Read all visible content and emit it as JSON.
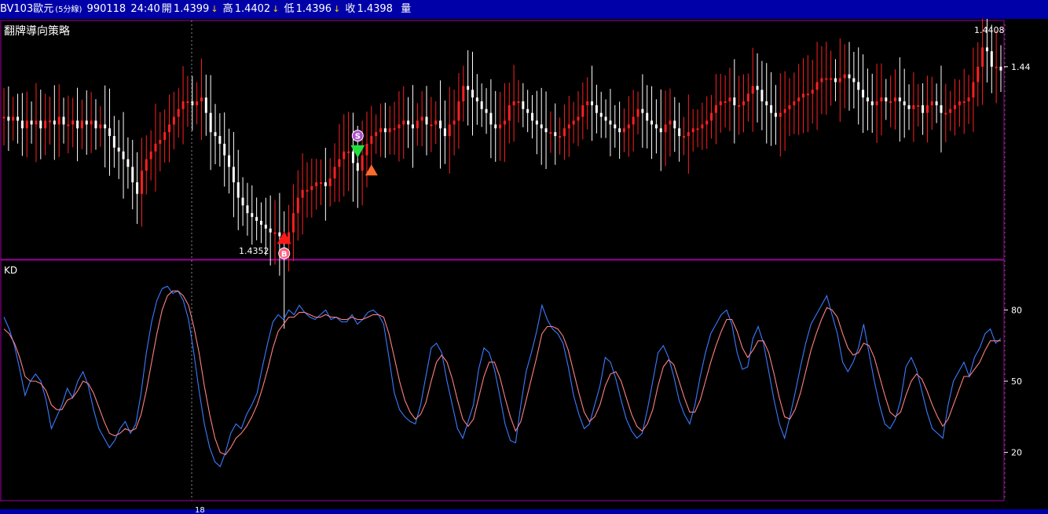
{
  "header": {
    "symbol": "BV103歐元",
    "interval": "(5分線)",
    "date": "990118",
    "time": "24:40",
    "open_label": "開",
    "open": "1.4399",
    "high_label": "高",
    "high": "1.4402",
    "low_label": "低",
    "low": "1.4396",
    "close_label": "收",
    "close": "1.4398",
    "volume_label": "量",
    "down_arrow": "↓"
  },
  "colors": {
    "background": "#000000",
    "titlebar": "#0000a8",
    "up_bar": "#ff2020",
    "down_bar": "#ffffff",
    "k_line": "#3a7bff",
    "d_line": "#ff8080",
    "frame": "#a000a0",
    "buy_marker": "#ff1a1a",
    "sell_marker": "#20e040",
    "alt_marker": "#ff6a2a"
  },
  "chart_data": [
    {
      "type": "bar",
      "title": "翻牌導向策略",
      "y_tick_labels": [
        "1.44"
      ],
      "high_label": "1.4408",
      "low_label": "1.4352",
      "ylim": [
        1.435,
        1.4412
      ],
      "session_divider_label": "18",
      "markers": [
        {
          "type": "buy",
          "label": "B",
          "price": 1.4354
        },
        {
          "type": "sell",
          "label": "S",
          "price": 1.4378
        },
        {
          "type": "up",
          "price": 1.4373
        }
      ],
      "series": [
        {
          "values": [
            1.4387,
            1.4386,
            1.4387,
            1.4386,
            1.4384,
            1.4386,
            1.4385,
            1.4386,
            1.4384,
            1.4386,
            1.4386,
            1.4385,
            1.4387,
            1.4385,
            1.4385,
            1.4386,
            1.4384,
            1.4386,
            1.4385,
            1.4386,
            1.4384,
            1.4385,
            1.4384,
            1.4382,
            1.4379,
            1.4378,
            1.4376,
            1.4374,
            1.437,
            1.4367,
            1.4373,
            1.4376,
            1.4378,
            1.438,
            1.4381,
            1.4383,
            1.4385,
            1.4387,
            1.4389,
            1.4391,
            1.4391,
            1.439,
            1.4391,
            1.4392,
            1.4388,
            1.4383,
            1.4382,
            1.438,
            1.4377,
            1.4374,
            1.437,
            1.4366,
            1.4364,
            1.4362,
            1.4361,
            1.436,
            1.4359,
            1.4358,
            1.4357,
            1.4357,
            1.4356,
            1.4354,
            1.4357,
            1.4362,
            1.4366,
            1.4368,
            1.4368,
            1.4369,
            1.437,
            1.437,
            1.4369,
            1.4371,
            1.4374,
            1.4376,
            1.4378,
            1.4378,
            1.4375,
            1.4373,
            1.4377,
            1.438,
            1.4382,
            1.4383,
            1.4384,
            1.4383,
            1.4384,
            1.4384,
            1.4385,
            1.4386,
            1.4385,
            1.4384,
            1.4386,
            1.4387,
            1.4385,
            1.4385,
            1.4386,
            1.4384,
            1.4382,
            1.4385,
            1.4386,
            1.4391,
            1.4395,
            1.4394,
            1.4392,
            1.4391,
            1.4389,
            1.4388,
            1.4385,
            1.4384,
            1.4385,
            1.4386,
            1.439,
            1.4391,
            1.4391,
            1.4389,
            1.4388,
            1.4386,
            1.4385,
            1.4384,
            1.4383,
            1.4383,
            1.4382,
            1.4382,
            1.4384,
            1.4385,
            1.4386,
            1.4387,
            1.439,
            1.4391,
            1.439,
            1.4388,
            1.4387,
            1.4386,
            1.4385,
            1.4384,
            1.4383,
            1.4384,
            1.4385,
            1.4387,
            1.4389,
            1.4388,
            1.4386,
            1.4385,
            1.4384,
            1.4383,
            1.4385,
            1.4386,
            1.4384,
            1.4382,
            1.4382,
            1.4383,
            1.4384,
            1.4384,
            1.4385,
            1.4386,
            1.4388,
            1.439,
            1.4391,
            1.4391,
            1.4392,
            1.439,
            1.439,
            1.4391,
            1.4393,
            1.4395,
            1.4394,
            1.4391,
            1.439,
            1.4388,
            1.4387,
            1.4388,
            1.4389,
            1.439,
            1.4391,
            1.4392,
            1.4393,
            1.4393,
            1.4394,
            1.4396,
            1.4397,
            1.4397,
            1.4397,
            1.4396,
            1.4397,
            1.4398,
            1.4397,
            1.4396,
            1.4394,
            1.4392,
            1.4391,
            1.439,
            1.4391,
            1.4392,
            1.4391,
            1.4391,
            1.4392,
            1.4391,
            1.439,
            1.4389,
            1.439,
            1.439,
            1.4388,
            1.439,
            1.4391,
            1.439,
            1.4388,
            1.4388,
            1.4389,
            1.439,
            1.4391,
            1.4391,
            1.4392,
            1.4396,
            1.44,
            1.4405,
            1.4404,
            1.44,
            1.44,
            1.4399
          ]
        }
      ]
    },
    {
      "type": "line",
      "title": "KD",
      "y_tick_labels": [
        "80",
        "50",
        "20"
      ],
      "ylim": [
        0,
        100
      ],
      "series": [
        {
          "name": "",
          "values": [
            77,
            72,
            65,
            55,
            44,
            50,
            53,
            50,
            42,
            30,
            35,
            40,
            47,
            43,
            50,
            54,
            48,
            38,
            30,
            26,
            22,
            25,
            30,
            33,
            28,
            32,
            45,
            62,
            75,
            84,
            89,
            90,
            87,
            88,
            84,
            76,
            62,
            46,
            32,
            22,
            16,
            14,
            20,
            28,
            32,
            30,
            36,
            40,
            45,
            56,
            66,
            75,
            78,
            76,
            80,
            78,
            82,
            79,
            77,
            76,
            78,
            80,
            76,
            77,
            75,
            75,
            78,
            74,
            76,
            79,
            80,
            78,
            74,
            60,
            45,
            38,
            35,
            33,
            32,
            40,
            52,
            64,
            66,
            62,
            50,
            40,
            30,
            26,
            33,
            40,
            55,
            64,
            62,
            55,
            44,
            32,
            25,
            24,
            40,
            54,
            62,
            71,
            82,
            76,
            72,
            70,
            66,
            56,
            44,
            36,
            30,
            32,
            40,
            48,
            60,
            58,
            51,
            42,
            34,
            29,
            26,
            28,
            38,
            50,
            62,
            65,
            60,
            52,
            42,
            36,
            32,
            40,
            52,
            62,
            70,
            74,
            78,
            80,
            74,
            62,
            55,
            56,
            68,
            73,
            66,
            54,
            42,
            32,
            26,
            35,
            45,
            56,
            66,
            74,
            78,
            82,
            86,
            78,
            70,
            58,
            54,
            58,
            64,
            74,
            62,
            50,
            40,
            32,
            30,
            34,
            42,
            56,
            60,
            55,
            46,
            37,
            30,
            28,
            26,
            40,
            50,
            54,
            58,
            52,
            60,
            64,
            70,
            72,
            66,
            68
          ]
        },
        {
          "name": "",
          "values": [
            72,
            70,
            66,
            60,
            52,
            50,
            50,
            49,
            46,
            40,
            38,
            38,
            42,
            43,
            46,
            50,
            49,
            45,
            39,
            33,
            28,
            27,
            28,
            30,
            29,
            30,
            36,
            46,
            58,
            70,
            80,
            86,
            88,
            88,
            86,
            82,
            73,
            62,
            48,
            36,
            26,
            20,
            19,
            22,
            26,
            28,
            31,
            35,
            40,
            47,
            55,
            64,
            71,
            74,
            77,
            77,
            79,
            79,
            78,
            77,
            77,
            78,
            77,
            77,
            76,
            76,
            77,
            76,
            76,
            77,
            78,
            78,
            77,
            70,
            60,
            50,
            42,
            37,
            34,
            36,
            41,
            50,
            58,
            61,
            58,
            51,
            42,
            34,
            31,
            34,
            43,
            52,
            58,
            58,
            52,
            43,
            35,
            29,
            33,
            42,
            51,
            60,
            70,
            73,
            73,
            72,
            69,
            63,
            54,
            45,
            37,
            33,
            35,
            40,
            48,
            53,
            54,
            50,
            43,
            36,
            31,
            29,
            32,
            38,
            48,
            56,
            59,
            57,
            50,
            43,
            37,
            37,
            42,
            50,
            58,
            65,
            71,
            76,
            76,
            71,
            64,
            60,
            63,
            67,
            67,
            62,
            53,
            43,
            35,
            34,
            38,
            45,
            54,
            63,
            70,
            76,
            81,
            80,
            77,
            70,
            64,
            61,
            62,
            66,
            65,
            60,
            52,
            44,
            37,
            35,
            37,
            44,
            50,
            53,
            51,
            46,
            40,
            35,
            31,
            34,
            40,
            46,
            52,
            52,
            55,
            58,
            63,
            67,
            67,
            67
          ]
        }
      ]
    }
  ]
}
